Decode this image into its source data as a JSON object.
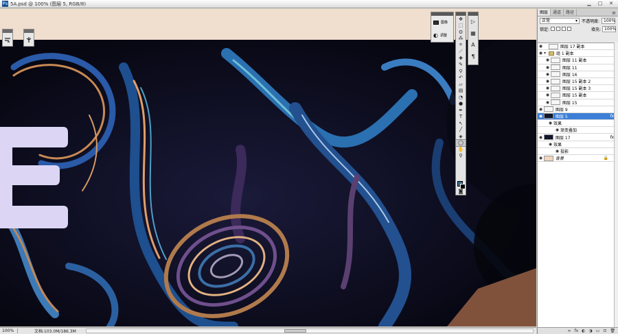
{
  "window": {
    "title": "5A.psd @ 100% (图层 5, RGB/8)",
    "buttons": [
      "▁",
      "□",
      "✕"
    ]
  },
  "status": {
    "zoom": "100%",
    "doc_info": "文档:103.0M/186.3M",
    "arrow": "▶"
  },
  "adjust_panel": {
    "row1_label": "图像",
    "row2_label": "调整"
  },
  "layers_panel": {
    "tabs": [
      "图层",
      "通道",
      "路径"
    ],
    "menu_icon": "≡",
    "blend_mode": "正常",
    "opacity_label": "不透明度:",
    "opacity_value": "100%",
    "lock_label": "锁定:",
    "fill_label": "填充:",
    "fill_value": "100%",
    "layers": [
      {
        "name": "图层 17 副本",
        "kind": "layer"
      },
      {
        "name": "组 1 副本",
        "kind": "group"
      },
      {
        "name": "图层 11 副本",
        "kind": "layer",
        "indent": true
      },
      {
        "name": "图层 11",
        "kind": "layer",
        "indent": true
      },
      {
        "name": "图层 16",
        "kind": "layer",
        "indent": true
      },
      {
        "name": "图层 15 副本 2",
        "kind": "layer",
        "indent": true
      },
      {
        "name": "图层 15 副本 3",
        "kind": "layer",
        "indent": true
      },
      {
        "name": "图层 15 副本",
        "kind": "layer",
        "indent": true
      },
      {
        "name": "图层 15",
        "kind": "layer",
        "indent": true
      },
      {
        "name": "图层 9",
        "kind": "layer"
      },
      {
        "name": "图层 5",
        "kind": "layer",
        "selected": true,
        "fx": "fx"
      },
      {
        "name": "效果",
        "kind": "effect"
      },
      {
        "name": "渐变叠加",
        "kind": "effect-item"
      },
      {
        "name": "图层 17",
        "kind": "layer",
        "fx": "fx"
      },
      {
        "name": "效果",
        "kind": "effect"
      },
      {
        "name": "投影",
        "kind": "effect-item"
      },
      {
        "name": "背景",
        "kind": "background"
      }
    ],
    "footer_icons": [
      "∞",
      "fx",
      "◐",
      "◑",
      "▭",
      "⊡",
      "🗑"
    ]
  },
  "colors": {
    "canvas_peach": "#f0dece",
    "letter_fill": "#dcd6f4",
    "brown_shape": "#80523c",
    "selected_layer": "#3d7fd6",
    "foreground_swatch": "#3a6a8c",
    "background_swatch": "#000000"
  }
}
